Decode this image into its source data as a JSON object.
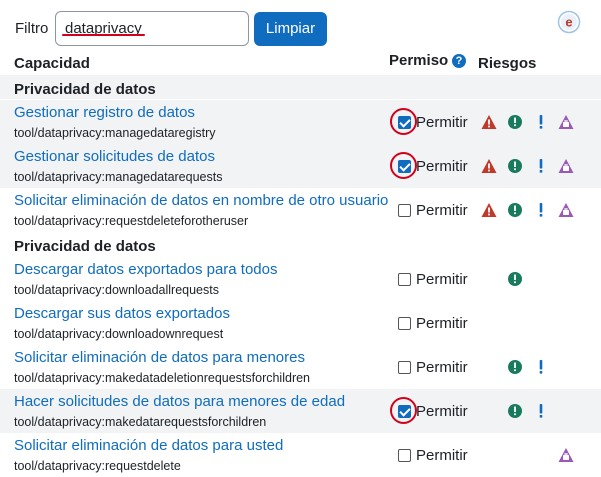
{
  "filter": {
    "label": "Filtro",
    "value": "dataprivacy",
    "clear_label": "Limpiar"
  },
  "header": {
    "capability": "Capacidad",
    "permission": "Permiso",
    "help": "?",
    "risks": "Riesgos"
  },
  "sections": [
    {
      "title": "Privacidad de datos"
    },
    {
      "title": "Privacidad de datos"
    }
  ],
  "rows": [
    {
      "name": "Gestionar registro de datos",
      "id": "tool/dataprivacy:managedataregistry",
      "checked": true,
      "highlighted": true,
      "permission_label": "Permitir",
      "risks": [
        "config-risk-icon",
        "personal-data-risk-icon",
        "xss-risk-icon",
        "data-loss-risk-icon"
      ]
    },
    {
      "name": "Gestionar solicitudes de datos",
      "id": "tool/dataprivacy:managedatarequests",
      "checked": true,
      "highlighted": true,
      "permission_label": "Permitir",
      "risks": [
        "config-risk-icon",
        "personal-data-risk-icon",
        "xss-risk-icon",
        "data-loss-risk-icon"
      ]
    },
    {
      "name": "Solicitar eliminación de datos en nombre de otro usuario",
      "id": "tool/dataprivacy:requestdeleteforotheruser",
      "checked": false,
      "highlighted": false,
      "permission_label": "Permitir",
      "risks": [
        "config-risk-icon",
        "personal-data-risk-icon",
        "xss-risk-icon",
        "data-loss-risk-icon"
      ]
    },
    {
      "name": "Descargar datos exportados para todos",
      "id": "tool/dataprivacy:downloadallrequests",
      "checked": false,
      "highlighted": false,
      "permission_label": "Permitir",
      "risks": [
        "personal-data-risk-icon"
      ]
    },
    {
      "name": "Descargar sus datos exportados",
      "id": "tool/dataprivacy:downloadownrequest",
      "checked": false,
      "highlighted": false,
      "permission_label": "Permitir",
      "risks": []
    },
    {
      "name": "Solicitar eliminación de datos para menores",
      "id": "tool/dataprivacy:makedatadeletionrequestsforchildren",
      "checked": false,
      "highlighted": false,
      "permission_label": "Permitir",
      "risks": [
        "personal-data-risk-icon",
        "xss-risk-icon"
      ]
    },
    {
      "name": "Hacer solicitudes de datos para menores de edad",
      "id": "tool/dataprivacy:makedatarequestsforchildren",
      "checked": true,
      "highlighted": true,
      "permission_label": "Permitir",
      "risks": [
        "personal-data-risk-icon",
        "xss-risk-icon"
      ]
    },
    {
      "name": "Solicitar eliminación de datos para usted",
      "id": "tool/dataprivacy:requestdelete",
      "checked": false,
      "highlighted": false,
      "permission_label": "Permitir",
      "risks": [
        "data-loss-risk-icon"
      ]
    }
  ],
  "colors": {
    "link": "#0f6cbf",
    "highlight_ring": "#d0021b",
    "row_alt": "#f1f3f5",
    "config_risk": "#c0392b",
    "personal_risk": "#1a7a5e",
    "xss_risk": "#0f6cbf",
    "data_loss_risk": "#9b59b6"
  }
}
